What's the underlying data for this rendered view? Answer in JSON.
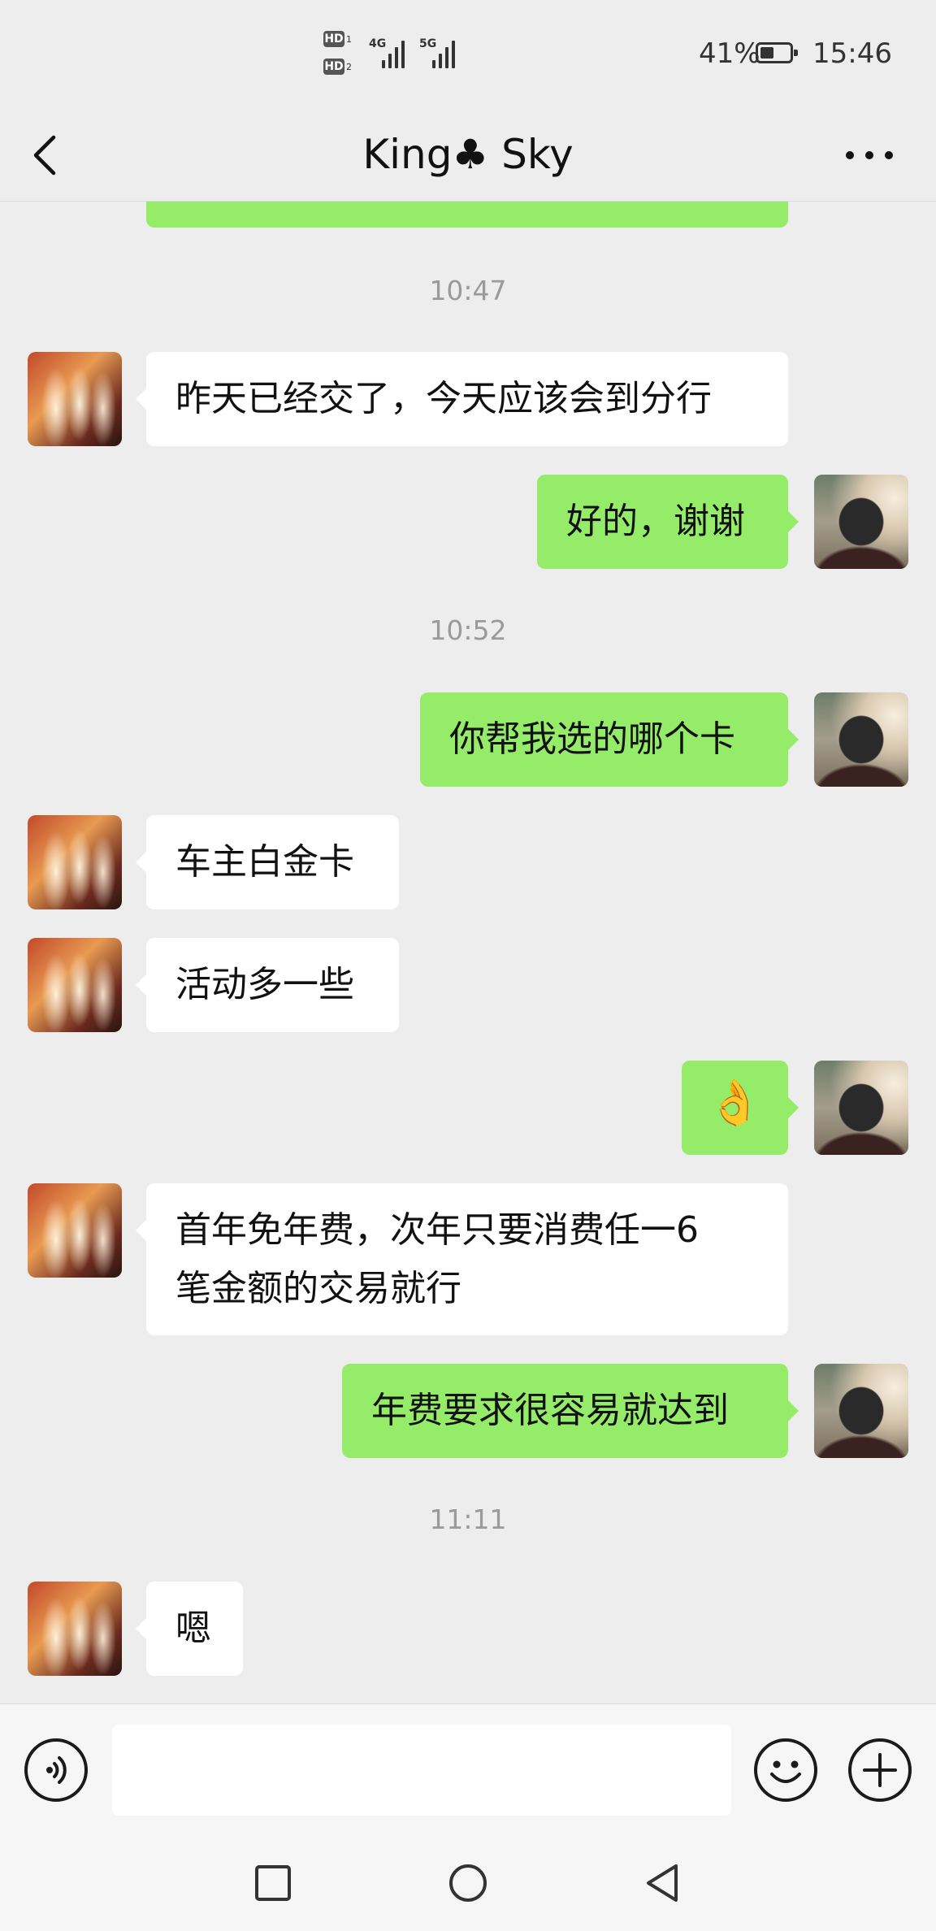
{
  "status_bar": {
    "hd1": "HD",
    "hd1_sub": "1",
    "hd2": "HD",
    "hd2_sub": "2",
    "net1": "4G",
    "net2": "5G",
    "battery": "41%",
    "time": "15:46"
  },
  "header": {
    "title": "King♣ Sky",
    "back_icon": "chevron-left-icon",
    "more_icon": "more-horizontal-icon"
  },
  "messages": [
    {
      "type": "timestamp",
      "text": "10:47"
    },
    {
      "type": "text",
      "from": "other",
      "text": "昨天已经交了，今天应该会到分行"
    },
    {
      "type": "text",
      "from": "self",
      "text": "好的，谢谢"
    },
    {
      "type": "timestamp",
      "text": "10:52"
    },
    {
      "type": "text",
      "from": "self",
      "text": "你帮我选的哪个卡"
    },
    {
      "type": "text",
      "from": "other",
      "text": "车主白金卡"
    },
    {
      "type": "text",
      "from": "other",
      "text": "活动多一些"
    },
    {
      "type": "emoji",
      "from": "self",
      "text": "👌"
    },
    {
      "type": "text",
      "from": "other",
      "lines": [
        "首年免年费，次年只要消费任一6",
        "笔金额的交易就行"
      ]
    },
    {
      "type": "text",
      "from": "self",
      "text": "年费要求很容易就达到"
    },
    {
      "type": "timestamp",
      "text": "11:11"
    },
    {
      "type": "text",
      "from": "other",
      "text": "嗯"
    }
  ],
  "input_bar": {
    "voice_icon": "voice-icon",
    "input_value": "",
    "emoji_icon": "smiley-icon",
    "plus_icon": "plus-icon"
  },
  "android_nav": {
    "recents_icon": "square-icon",
    "home_icon": "circle-icon",
    "back_icon": "triangle-back-icon"
  },
  "colors": {
    "background": "#ededed",
    "bubble_self": "#95ec69",
    "bubble_other": "#ffffff",
    "timestamp": "#9a9a9a"
  }
}
